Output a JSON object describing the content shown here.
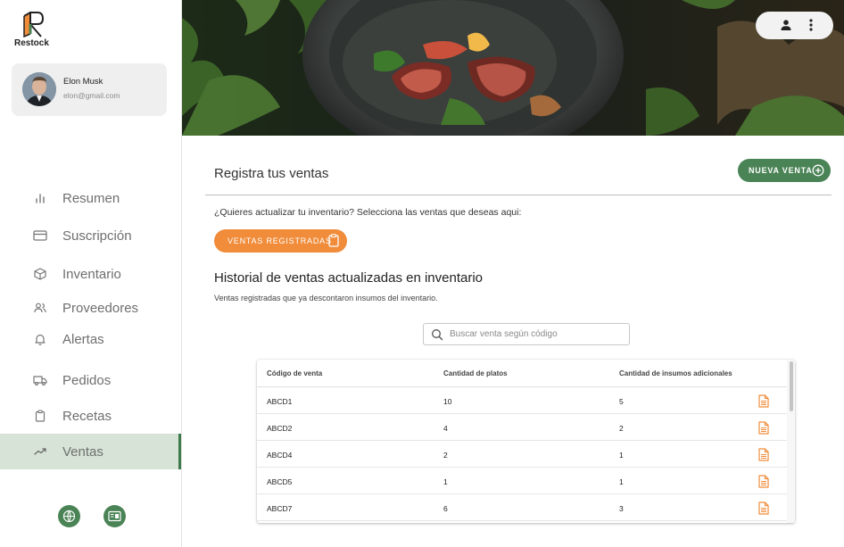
{
  "app": {
    "name": "Restock"
  },
  "profile": {
    "name": "Elon Musk",
    "email": "elon@gmail.com"
  },
  "nav": [
    {
      "label": "Resumen",
      "icon": "bar-chart-icon"
    },
    {
      "label": "Suscripción",
      "icon": "credit-card-icon"
    },
    {
      "label": "Inventario",
      "icon": "box-icon"
    },
    {
      "label": "Proveedores",
      "icon": "users-icon"
    },
    {
      "label": "Alertas",
      "icon": "bell-icon"
    },
    {
      "label": "Pedidos",
      "icon": "truck-icon"
    },
    {
      "label": "Recetas",
      "icon": "clipboard-icon"
    },
    {
      "label": "Ventas",
      "icon": "trending-up-icon",
      "active": true
    }
  ],
  "main": {
    "title": "Registra tus ventas",
    "new_sale_label": "NUEVA VENTA",
    "prompt": "¿Quieres actualizar tu inventario? Selecciona las ventas que deseas aqui:",
    "registered_label": "VENTAS REGISTRADAS",
    "history_title": "Historial de ventas actualizadas en inventario",
    "history_subtitle": "Ventas registradas que ya descontaron insumos del inventario.",
    "search_placeholder": "Buscar venta según código"
  },
  "table": {
    "columns": [
      "Código de venta",
      "Cantidad de platos",
      "Cantidad de insumos adicionales"
    ],
    "rows": [
      {
        "code": "ABCD1",
        "plates": "10",
        "extra": "5"
      },
      {
        "code": "ABCD2",
        "plates": "4",
        "extra": "2"
      },
      {
        "code": "ABCD4",
        "plates": "2",
        "extra": "1"
      },
      {
        "code": "ABCD5",
        "plates": "1",
        "extra": "1"
      },
      {
        "code": "ABCD7",
        "plates": "6",
        "extra": "3"
      }
    ]
  },
  "colors": {
    "primary_green": "#4a8355",
    "accent_orange": "#f08c3a",
    "active_bg": "#d6e3d6"
  }
}
